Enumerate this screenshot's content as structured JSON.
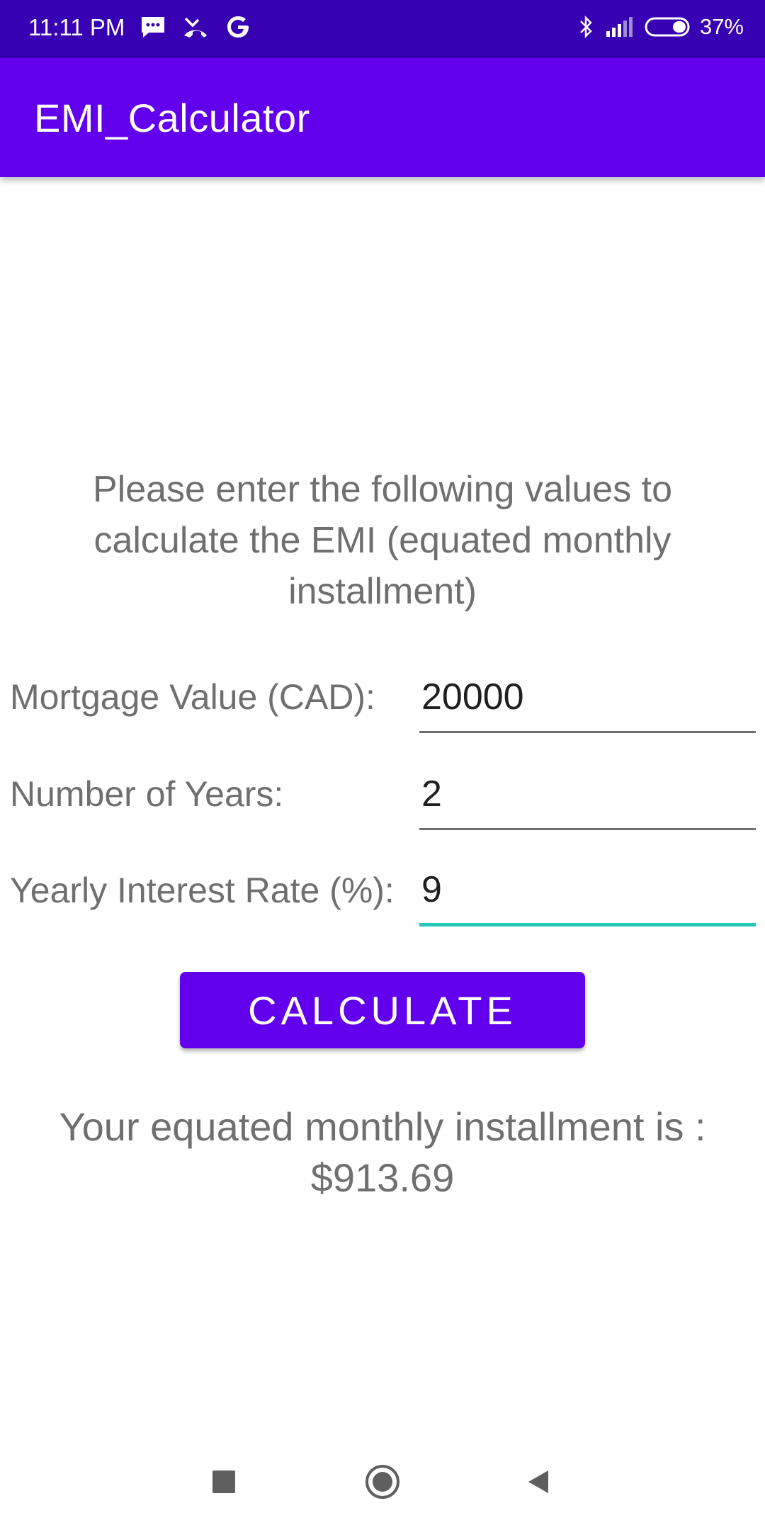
{
  "status_bar": {
    "time": "11:11 PM",
    "battery": "37%",
    "left_icons": [
      "message-icon",
      "missed-call-icon",
      "google-icon"
    ],
    "right_icons": [
      "bluetooth-icon",
      "signal-icon",
      "battery-icon"
    ]
  },
  "app_bar": {
    "title": "EMI_Calculator"
  },
  "form": {
    "instruction": "Please enter the following values to calculate the EMI (equated monthly installment)",
    "mortgage": {
      "label": "Mortgage Value (CAD):",
      "value": "20000"
    },
    "years": {
      "label": "Number of Years:",
      "value": "2"
    },
    "rate": {
      "label": "Yearly Interest Rate (%):",
      "value": "9"
    },
    "calculate_label": "CALCULATE"
  },
  "result": {
    "line1": "Your equated monthly installment is :",
    "line2": "$913.69"
  },
  "nav_bar": {
    "buttons": [
      "recents-icon",
      "home-icon",
      "back-icon"
    ]
  },
  "colors": {
    "status_bar": "#3700B3",
    "primary": "#6200EE",
    "accent": "#26C6BA"
  }
}
